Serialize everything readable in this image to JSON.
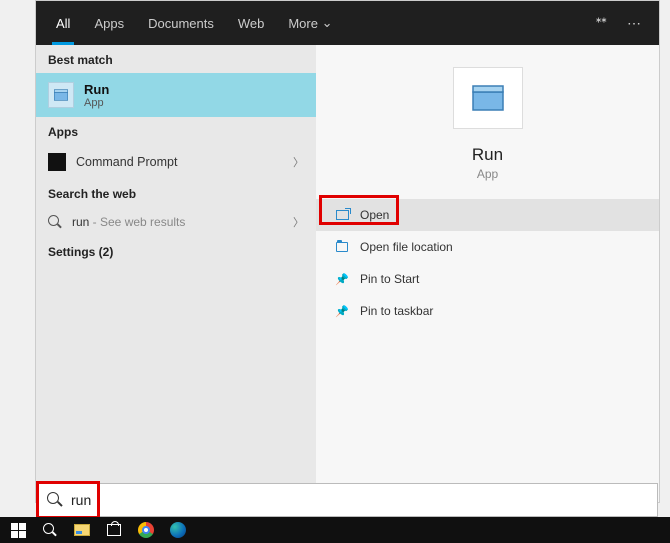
{
  "tabs": {
    "all": "All",
    "apps": "Apps",
    "documents": "Documents",
    "web": "Web",
    "more": "More"
  },
  "sections": {
    "best_match": "Best match",
    "apps": "Apps",
    "search_web": "Search the web",
    "settings": "Settings (2)"
  },
  "best_match": {
    "title": "Run",
    "subtitle": "App"
  },
  "apps_list": {
    "command_prompt": "Command Prompt"
  },
  "web": {
    "prefix": "run",
    "suffix": " - See web results"
  },
  "detail": {
    "title": "Run",
    "subtitle": "App",
    "actions": {
      "open": "Open",
      "open_location": "Open file location",
      "pin_start": "Pin to Start",
      "pin_taskbar": "Pin to taskbar"
    }
  },
  "search_input": "run"
}
